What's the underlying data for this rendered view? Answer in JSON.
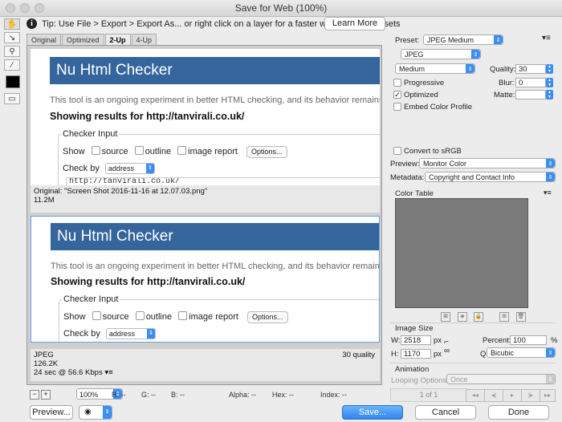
{
  "window": {
    "title": "Save for Web (100%)"
  },
  "tip": {
    "text": "Tip: Use File > Export > Export As...  or right click on a layer for a faster way to export assets",
    "learn_more": "Learn More"
  },
  "tools": [
    {
      "name": "hand-tool-icon",
      "glyph": "✋"
    },
    {
      "name": "slice-select-tool-icon",
      "glyph": "↘"
    },
    {
      "name": "zoom-tool-icon",
      "glyph": "🔍"
    },
    {
      "name": "eyedropper-tool-icon",
      "glyph": "⁄"
    },
    {
      "name": "eyedropper-color-swatch",
      "glyph": ""
    },
    {
      "name": "toggle-slices-icon",
      "glyph": "▭"
    }
  ],
  "tabs": [
    "Original",
    "Optimized",
    "2-Up",
    "4-Up"
  ],
  "preview": {
    "page_title": "Nu Html Checker",
    "description": "This tool is an ongoing experiment in better HTML checking, and its behavior remains subject to",
    "results": "Showing results for http://tanvirali.co.uk/",
    "legend": "Checker Input",
    "show_label": "Show",
    "opt_source": "source",
    "opt_outline": "outline",
    "opt_image_report": "image report",
    "options_btn": "Options...",
    "check_by": "Check by",
    "check_by_value": "address",
    "url": "http://tanvirali.co.uk/"
  },
  "original_info": {
    "line1": "Original: \"Screen Shot 2016-11-16 at 12.07.03.png\"",
    "line2": "11.2M"
  },
  "optimized_info": {
    "format": "JPEG",
    "size": "126.2K",
    "time": "24 sec @ 56.6 Kbps",
    "quality": "30 quality"
  },
  "bottom": {
    "zoom": "100%",
    "r": "R: --",
    "g": "G: --",
    "b": "B: --",
    "alpha": "Alpha: --",
    "hex": "Hex: --",
    "index": "Index: --"
  },
  "footer": {
    "preview": "Preview...",
    "save": "Save...",
    "cancel": "Cancel",
    "done": "Done"
  },
  "settings": {
    "preset_label": "Preset:",
    "preset": "JPEG Medium",
    "format": "JPEG",
    "quality_level": "Medium",
    "quality_label": "Quality:",
    "quality": "30",
    "progressive": "Progressive",
    "blur_label": "Blur:",
    "blur": "0",
    "optimized": "Optimized",
    "matte_label": "Matte:",
    "embed_profile": "Embed Color Profile",
    "convert_srgb": "Convert to sRGB",
    "preview_label": "Preview:",
    "preview_value": "Monitor Color",
    "metadata_label": "Metadata:",
    "metadata_value": "Copyright and Contact Info",
    "color_table": "Color Table",
    "image_size": "Image Size",
    "w_label": "W:",
    "w": "2518",
    "h_label": "H:",
    "h": "1170",
    "unit": "px",
    "percent_label": "Percent:",
    "percent": "100",
    "percent_unit": "%",
    "resample_label": "Quality:",
    "resample": "Bicubic",
    "animation": "Animation",
    "looping_label": "Looping Options:",
    "looping": "Once",
    "frame": "1 of 1"
  },
  "colors": {
    "header_blue": "#34659c",
    "accent_blue": "#3a8ef6"
  }
}
